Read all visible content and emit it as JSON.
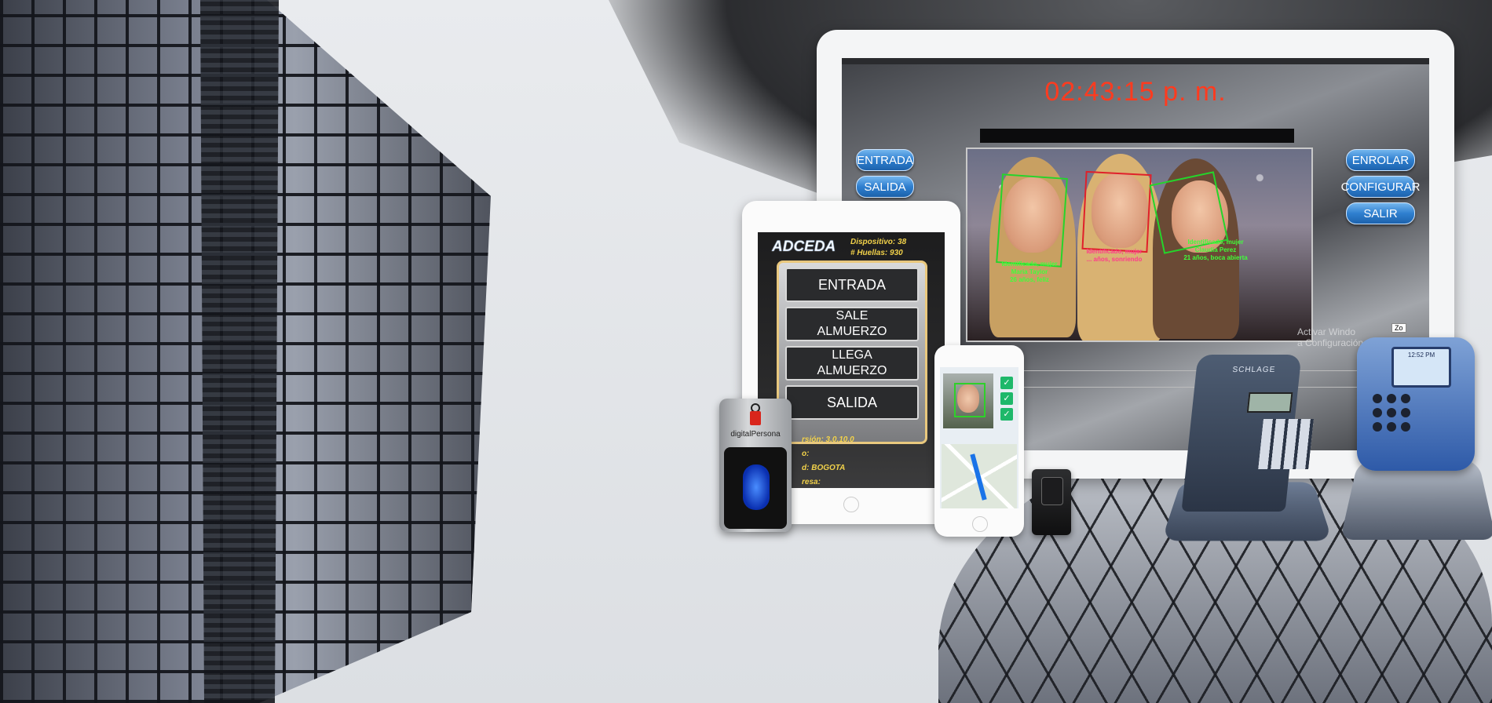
{
  "monitor": {
    "clock": "02:43:15 p. m.",
    "left_buttons": [
      "ENTRADA",
      "SALIDA"
    ],
    "right_buttons": [
      "ENROLAR",
      "CONFIGURAR",
      "SALIR"
    ],
    "face_labels": [
      "Identificado, mujer\nMaria Taylor\n26 años, feliz",
      "Identificado, mujer\n... años, sonriendo",
      "Identificado, mujer\nClaudia Perez\n21 años, boca abierta"
    ],
    "watermark": "Activar Windo\na Configuración pa",
    "zoom_label": "Zo"
  },
  "tablet": {
    "logo": "ADCEDA",
    "dispositivo": "Dispositivo: 38",
    "huellas": "# Huellas: 930",
    "buttons": [
      "ENTRADA",
      "SALE\nALMUERZO",
      "LLEGA\nALMUERZO",
      "SALIDA"
    ],
    "footer_version": "rsión: 3.0.10.0",
    "footer_field_1": "o:",
    "footer_city": "d: BOGOTA",
    "footer_field_3": "resa:"
  },
  "reader": {
    "brand": "digitalPersona"
  },
  "handpunch": {
    "brand": "SCHLAGE",
    "display_time": "12:52 PM"
  },
  "colors": {
    "clock": "#ff3b1f",
    "button_blue": "#2f7fcf",
    "tablet_accent": "#e9c87e",
    "label_green": "#40ff3a",
    "sensor_blue": "#0a2fb0"
  }
}
